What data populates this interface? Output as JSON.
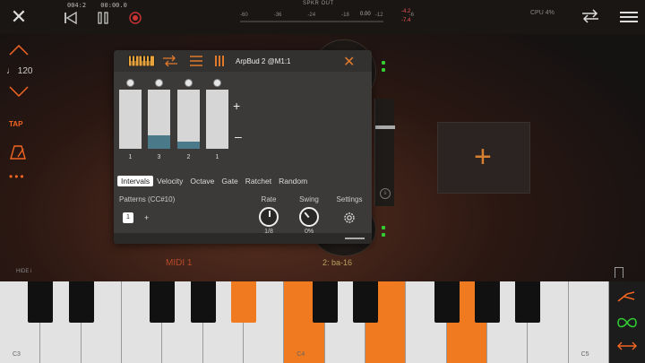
{
  "transport": {
    "position": "004:2",
    "time": "00:00.0"
  },
  "meter": {
    "label": "SPKR OUT",
    "ticks": [
      "-60",
      "-36",
      "-24",
      "-18",
      "-12",
      "-6"
    ],
    "level_values": [
      "-4.2",
      "-7.4"
    ],
    "mid_value": "0.00"
  },
  "cpu": {
    "label": "CPU",
    "value": "4%"
  },
  "tempo": "♩ 120",
  "left_tools": {
    "tap_label": "TAP",
    "more_label": "•••"
  },
  "plugin": {
    "title": "ArpBud 2 @M1:1",
    "sliders": [
      {
        "value": "1",
        "fill": 0.0
      },
      {
        "value": "3",
        "fill": 0.22
      },
      {
        "value": "2",
        "fill": 0.12
      },
      {
        "value": "1",
        "fill": 0.0
      }
    ],
    "tabs": [
      "Intervals",
      "Velocity",
      "Octave",
      "Gate",
      "Ratchet",
      "Random"
    ],
    "active_tab": 0,
    "patterns_label": "Patterns (CC#10)",
    "pattern_value": "1",
    "pattern_add": "+",
    "plus_label": "+",
    "minus_label": "–",
    "knobs": [
      {
        "label": "Rate",
        "value": "1/8"
      },
      {
        "label": "Swing",
        "value": "0%"
      },
      {
        "label": "Settings",
        "value": ""
      }
    ]
  },
  "slots": {
    "midi_label": "MIDI 1",
    "slot2_label": "2: ba-16",
    "hide_label": "HIDE i"
  },
  "keyboard": {
    "labels": [
      "C3",
      "C4",
      "C5"
    ],
    "active_white": [
      7,
      9,
      11
    ],
    "active_black": [
      4
    ],
    "accent": "#f07a20"
  },
  "colors": {
    "accent": "#f26522",
    "panel": "#3c3a38",
    "slider_fill": "#4a7a8a"
  }
}
